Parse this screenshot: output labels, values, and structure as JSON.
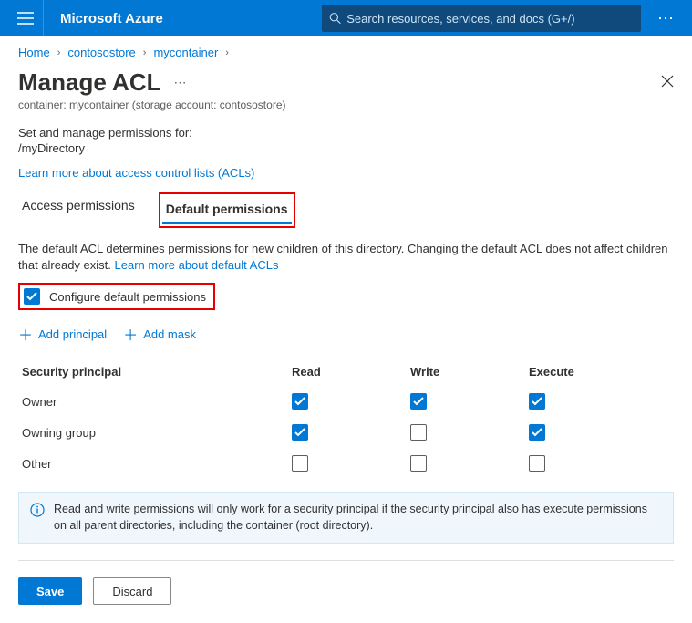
{
  "header": {
    "brand": "Microsoft Azure",
    "search_placeholder": "Search resources, services, and docs (G+/)"
  },
  "breadcrumb": [
    "Home",
    "contosostore",
    "mycontainer"
  ],
  "page": {
    "title": "Manage ACL",
    "subtitle": "container: mycontainer (storage account: contosostore)",
    "intro": "Set and manage permissions for:",
    "path": "/myDirectory",
    "learn_acl_link": "Learn more about access control lists (ACLs)"
  },
  "tabs": {
    "access": "Access permissions",
    "default": "Default permissions"
  },
  "default_desc_part1": "The default ACL determines permissions for new children of this directory. Changing the default ACL does not affect children that already exist. ",
  "default_desc_link": "Learn more about default ACLs",
  "configure_label": "Configure default permissions",
  "add": {
    "principal": "Add principal",
    "mask": "Add mask"
  },
  "table": {
    "headers": {
      "principal": "Security principal",
      "read": "Read",
      "write": "Write",
      "execute": "Execute"
    },
    "rows": [
      {
        "name": "Owner",
        "read": true,
        "write": true,
        "execute": true
      },
      {
        "name": "Owning group",
        "read": true,
        "write": false,
        "execute": true
      },
      {
        "name": "Other",
        "read": false,
        "write": false,
        "execute": false
      }
    ]
  },
  "info_text": "Read and write permissions will only work for a security principal if the security principal also has execute permissions on all parent directories, including the container (root directory).",
  "footer": {
    "save": "Save",
    "discard": "Discard"
  }
}
